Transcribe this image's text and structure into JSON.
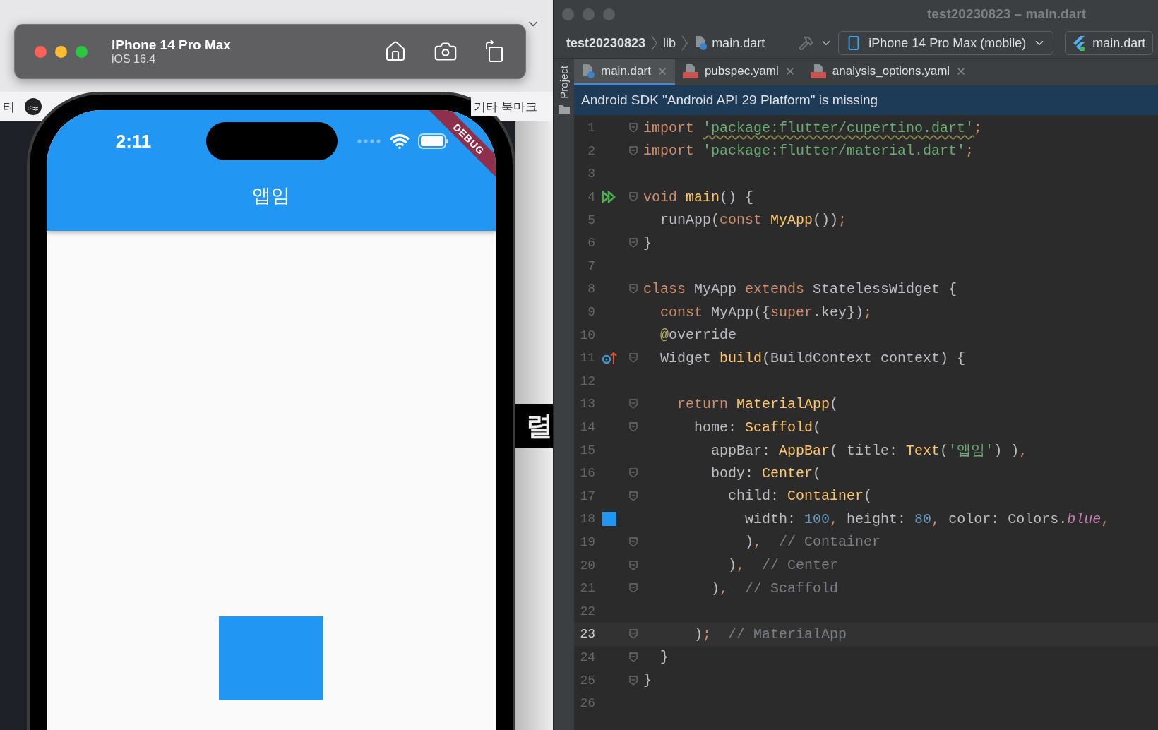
{
  "browser": {
    "bookmark_left": "티",
    "bookmark_right": "기타 북마크",
    "side_label": "렬"
  },
  "simulator": {
    "device": "iPhone 14 Pro Max",
    "os": "iOS 16.4"
  },
  "phone": {
    "time": "2:11",
    "ribbon": "DEBUG",
    "app_title": "앱임"
  },
  "ide": {
    "title": "test20230823 – main.dart",
    "breadcrumbs": [
      {
        "text": "test20230823",
        "kind": "project"
      },
      {
        "text": "lib",
        "kind": "folder"
      },
      {
        "text": "main.dart",
        "kind": "file"
      }
    ],
    "device_selector": "iPhone 14 Pro Max (mobile)",
    "run_config": "main.dart",
    "side_panel": "Project",
    "tabs": [
      {
        "label": "main.dart",
        "kind": "dart",
        "selected": true
      },
      {
        "label": "pubspec.yaml",
        "kind": "yaml",
        "selected": false
      },
      {
        "label": "analysis_options.yaml",
        "kind": "yaml",
        "selected": false
      }
    ],
    "banner": "Android SDK \"Android API 29 Platform\" is missing",
    "lines": [
      {
        "number": "1",
        "fold": true,
        "current": false,
        "tokens": [
          {
            "kind": "kw",
            "text": "import "
          },
          {
            "kind": "warn",
            "text": "'package:flutter/cupertino.dart'"
          },
          {
            "kind": "punct",
            "text": ";"
          }
        ]
      },
      {
        "number": "2",
        "fold": true,
        "current": false,
        "tokens": [
          {
            "kind": "kw",
            "text": "import "
          },
          {
            "kind": "str",
            "text": "'package:flutter/material.dart'"
          },
          {
            "kind": "punct",
            "text": ";"
          }
        ]
      },
      {
        "number": "3",
        "fold": false,
        "current": false
      },
      {
        "number": "4",
        "fold": true,
        "current": false,
        "kind": "run",
        "tokens": [
          {
            "kind": "kw",
            "text": "void "
          },
          {
            "kind": "fn",
            "text": "main"
          },
          {
            "kind": "plain",
            "text": "() {"
          }
        ]
      },
      {
        "number": "5",
        "fold": false,
        "current": false,
        "tokens": [
          {
            "kind": "plain",
            "text": "  runApp("
          },
          {
            "kind": "kw",
            "text": "const "
          },
          {
            "kind": "fn",
            "text": "MyApp"
          },
          {
            "kind": "plain",
            "text": "())"
          },
          {
            "kind": "punct",
            "text": ";"
          }
        ]
      },
      {
        "number": "6",
        "fold": true,
        "current": false,
        "tokens": [
          {
            "kind": "plain",
            "text": "}"
          }
        ]
      },
      {
        "number": "7",
        "fold": false,
        "current": false
      },
      {
        "number": "8",
        "fold": true,
        "current": false,
        "tokens": [
          {
            "kind": "kw",
            "text": "class"
          },
          {
            "kind": "plain",
            "text": " MyApp "
          },
          {
            "kind": "kw",
            "text": "extends"
          },
          {
            "kind": "plain",
            "text": " StatelessWidget {"
          }
        ]
      },
      {
        "number": "9",
        "fold": false,
        "current": false,
        "tokens": [
          {
            "kind": "kw",
            "text": "  const"
          },
          {
            "kind": "plain",
            "text": " MyApp({"
          },
          {
            "kind": "kw",
            "text": "super"
          },
          {
            "kind": "plain",
            "text": ".key})"
          },
          {
            "kind": "punct",
            "text": ";"
          }
        ]
      },
      {
        "number": "10",
        "fold": false,
        "current": false,
        "tokens": [
          {
            "kind": "annot",
            "text": "  @"
          },
          {
            "kind": "plain",
            "text": "override"
          }
        ]
      },
      {
        "number": "11",
        "fold": true,
        "current": false,
        "kind": "override",
        "tokens": [
          {
            "kind": "plain",
            "text": "  Widget "
          },
          {
            "kind": "fn",
            "text": "build"
          },
          {
            "kind": "plain",
            "text": "(BuildContext context) {"
          }
        ]
      },
      {
        "number": "12",
        "fold": false,
        "current": false
      },
      {
        "number": "13",
        "fold": true,
        "current": false,
        "tokens": [
          {
            "kind": "kw",
            "text": "    return "
          },
          {
            "kind": "fn",
            "text": "MaterialApp"
          },
          {
            "kind": "plain",
            "text": "("
          }
        ]
      },
      {
        "number": "14",
        "fold": true,
        "current": false,
        "tokens": [
          {
            "kind": "plain",
            "text": "      home: "
          },
          {
            "kind": "fn",
            "text": "Scaffold"
          },
          {
            "kind": "plain",
            "text": "("
          }
        ]
      },
      {
        "number": "15",
        "fold": false,
        "current": false,
        "tokens": [
          {
            "kind": "plain",
            "text": "        appBar: "
          },
          {
            "kind": "fn",
            "text": "AppBar"
          },
          {
            "kind": "plain",
            "text": "( title: "
          },
          {
            "kind": "fn",
            "text": "Text"
          },
          {
            "kind": "plain",
            "text": "("
          },
          {
            "kind": "str",
            "text": "'앱임'"
          },
          {
            "kind": "plain",
            "text": ") )"
          },
          {
            "kind": "punct",
            "text": ","
          }
        ]
      },
      {
        "number": "16",
        "fold": true,
        "current": false,
        "tokens": [
          {
            "kind": "plain",
            "text": "        body: "
          },
          {
            "kind": "fn",
            "text": "Center"
          },
          {
            "kind": "plain",
            "text": "("
          }
        ]
      },
      {
        "number": "17",
        "fold": true,
        "current": false,
        "tokens": [
          {
            "kind": "plain",
            "text": "          child: "
          },
          {
            "kind": "fn",
            "text": "Container"
          },
          {
            "kind": "plain",
            "text": "("
          }
        ]
      },
      {
        "number": "18",
        "fold": false,
        "current": false,
        "kind": "color",
        "tokens": [
          {
            "kind": "plain",
            "text": "            width: "
          },
          {
            "kind": "num",
            "text": "100"
          },
          {
            "kind": "punct",
            "text": ","
          },
          {
            "kind": "plain",
            "text": " height: "
          },
          {
            "kind": "num",
            "text": "80"
          },
          {
            "kind": "punct",
            "text": ","
          },
          {
            "kind": "plain",
            "text": " color: Colors."
          },
          {
            "kind": "field",
            "text": "blue"
          },
          {
            "kind": "punct",
            "text": ","
          }
        ]
      },
      {
        "number": "19",
        "fold": true,
        "current": false,
        "tokens": [
          {
            "kind": "plain",
            "text": "            )"
          },
          {
            "kind": "punct",
            "text": ","
          },
          {
            "kind": "comment",
            "text": "  // Container"
          }
        ]
      },
      {
        "number": "20",
        "fold": true,
        "current": false,
        "tokens": [
          {
            "kind": "plain",
            "text": "          )"
          },
          {
            "kind": "punct",
            "text": ","
          },
          {
            "kind": "comment",
            "text": "  // Center"
          }
        ]
      },
      {
        "number": "21",
        "fold": true,
        "current": false,
        "tokens": [
          {
            "kind": "plain",
            "text": "        )"
          },
          {
            "kind": "punct",
            "text": ","
          },
          {
            "kind": "comment",
            "text": "  // Scaffold"
          }
        ]
      },
      {
        "number": "22",
        "fold": false,
        "current": false
      },
      {
        "number": "23",
        "fold": true,
        "current": true,
        "tokens": [
          {
            "kind": "plain",
            "text": "      )"
          },
          {
            "kind": "punct",
            "text": ";"
          },
          {
            "kind": "comment",
            "text": "  // MaterialApp"
          }
        ]
      },
      {
        "number": "24",
        "fold": true,
        "current": false,
        "tokens": [
          {
            "kind": "plain",
            "text": "  }"
          }
        ]
      },
      {
        "number": "25",
        "fold": true,
        "current": false,
        "tokens": [
          {
            "kind": "plain",
            "text": "}"
          }
        ]
      },
      {
        "number": "26",
        "fold": false,
        "current": false
      }
    ]
  }
}
